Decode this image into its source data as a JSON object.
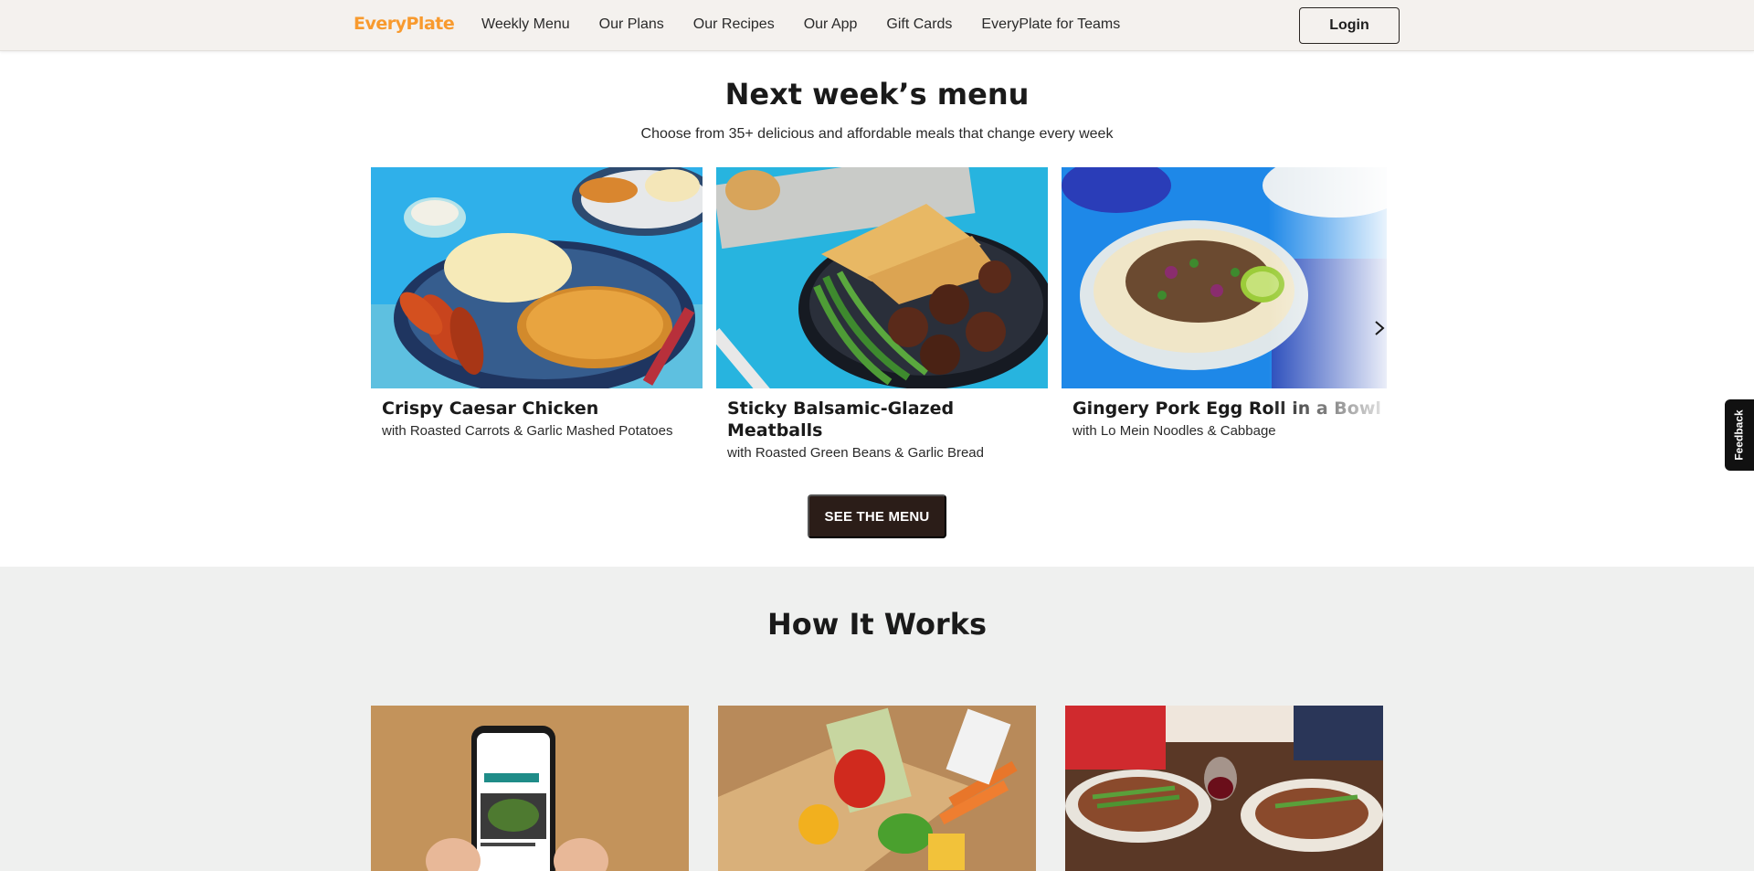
{
  "header": {
    "logo": "EveryPlate",
    "nav": [
      "Weekly Menu",
      "Our Plans",
      "Our Recipes",
      "Our App",
      "Gift Cards",
      "EveryPlate for Teams"
    ],
    "login_label": "Login"
  },
  "menu": {
    "title": "Next week’s menu",
    "subtitle": "Choose from 35+ delicious and affordable meals that change every week",
    "cards": [
      {
        "title": "Crispy Caesar Chicken",
        "subtitle": "with Roasted Carrots & Garlic Mashed Potatoes"
      },
      {
        "title": "Sticky Balsamic-Glazed Meatballs",
        "subtitle": "with Roasted Green Beans & Garlic Bread"
      },
      {
        "title": "Gingery Pork Egg Roll in a Bowl",
        "subtitle": "with Lo Mein Noodles & Cabbage"
      }
    ],
    "cta_label": "SEE THE MENU"
  },
  "how": {
    "title": "How It Works"
  },
  "feedback_label": "Feedback",
  "colors": {
    "brand_orange": "#f89a2e",
    "cta_dark": "#2b1d18",
    "header_bg": "#f4f1ee",
    "section_gray": "#eff0ef",
    "food_blue": "#27aee8"
  },
  "icons": [
    "chevron-right-icon"
  ]
}
